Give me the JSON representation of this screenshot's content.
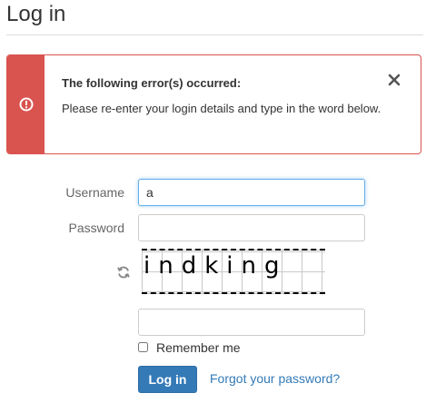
{
  "page": {
    "title": "Log in"
  },
  "alert": {
    "heading": "The following error(s) occurred:",
    "message": "Please re-enter your login details and type in the word below.",
    "icon": "error-circle-icon",
    "close_icon": "close-icon",
    "accent_color": "#d9534f"
  },
  "form": {
    "username_label": "Username",
    "username_value": "a",
    "password_label": "Password",
    "password_value": "",
    "captcha_word": "indking",
    "captcha_input_value": "",
    "refresh_icon": "refresh-icon",
    "remember_label": "Remember me",
    "remember_checked": false,
    "login_button": "Log in",
    "forgot_link": "Forgot your password?",
    "primary_color": "#337ab7"
  }
}
